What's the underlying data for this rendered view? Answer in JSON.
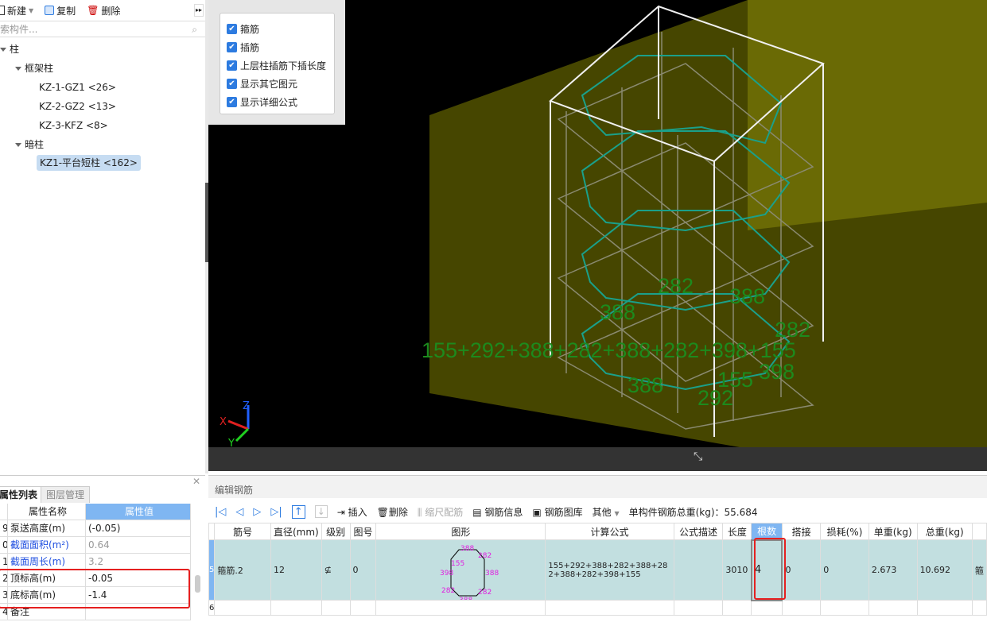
{
  "toolbar": {
    "new_label": "新建",
    "copy_label": "复制",
    "delete_label": "删除"
  },
  "search": {
    "placeholder": "索构件..."
  },
  "tree": {
    "root": "柱",
    "groups": [
      {
        "label": "框架柱",
        "items": [
          "KZ-1-GZ1 <26>",
          "KZ-2-GZ2 <13>",
          "KZ-3-KFZ <8>"
        ]
      },
      {
        "label": "暗柱",
        "items": [
          "KZ1-平台短柱 <162>"
        ]
      }
    ],
    "selected": "KZ1-平台短柱 <162>"
  },
  "view_options": [
    {
      "label": "箍筋",
      "checked": true
    },
    {
      "label": "插筋",
      "checked": true
    },
    {
      "label": "上层柱插筋下插长度",
      "checked": true
    },
    {
      "label": "显示其它图元",
      "checked": true
    },
    {
      "label": "显示详细公式",
      "checked": true
    }
  ],
  "viewport": {
    "formula_label": "155+292+388+282+388+282+398+155",
    "dim_labels": [
      "282",
      "388",
      "388",
      "282",
      "388",
      "155",
      "398",
      "292"
    ],
    "axes": {
      "x": "X",
      "y": "Y",
      "z": "Z"
    }
  },
  "properties": {
    "tabs": [
      "属性列表",
      "图层管理"
    ],
    "headers": [
      "属性名称",
      "属性值"
    ],
    "rows": [
      {
        "num": "9",
        "name": "泵送高度(m)",
        "value": "(-0.05)",
        "link": false
      },
      {
        "num": "0",
        "name": "截面面积(m²)",
        "value": "0.64",
        "link": true
      },
      {
        "num": "1",
        "name": "截面周长(m)",
        "value": "3.2",
        "link": true
      },
      {
        "num": "2",
        "name": "顶标高(m)",
        "value": "-0.05",
        "link": false
      },
      {
        "num": "3",
        "name": "底标高(m)",
        "value": "-1.4",
        "link": false
      },
      {
        "num": "4",
        "name": "备注",
        "value": "",
        "link": false
      }
    ]
  },
  "rebar": {
    "title": "编辑钢筋",
    "toolbar": {
      "insert": "插入",
      "delete": "删除",
      "scale": "缩尺配筋",
      "info": "钢筋信息",
      "library": "钢筋图库",
      "other": "其他",
      "total_label": "单构件钢筋总重(kg)：55.684"
    },
    "headers": [
      "筋号",
      "直径(mm)",
      "级别",
      "图号",
      "图形",
      "计算公式",
      "公式描述",
      "长度",
      "根数",
      "搭接",
      "损耗(%)",
      "单重(kg)",
      "总重(kg)"
    ],
    "rows": [
      {
        "num": "5",
        "name": "箍筋.2",
        "diameter": "12",
        "grade": "⊈",
        "figure": "0",
        "formula": "155+292+388+282+388+282+388+282+398+155",
        "desc": "",
        "length": "3010",
        "count": "4",
        "lap": "0",
        "loss": "0",
        "unit_weight": "2.673",
        "total_weight": "10.692",
        "extra": "箍"
      },
      {
        "num": "6"
      }
    ],
    "shape_labels": [
      "388",
      "282",
      "388",
      "282",
      "388",
      "282",
      "398",
      "155"
    ]
  },
  "colors": {
    "accent": "#2d7be0",
    "highlight": "#e52020",
    "selected_row": "#c2dfe0",
    "dim_label": "#1d8a1d",
    "shape_label": "#e020e0"
  }
}
